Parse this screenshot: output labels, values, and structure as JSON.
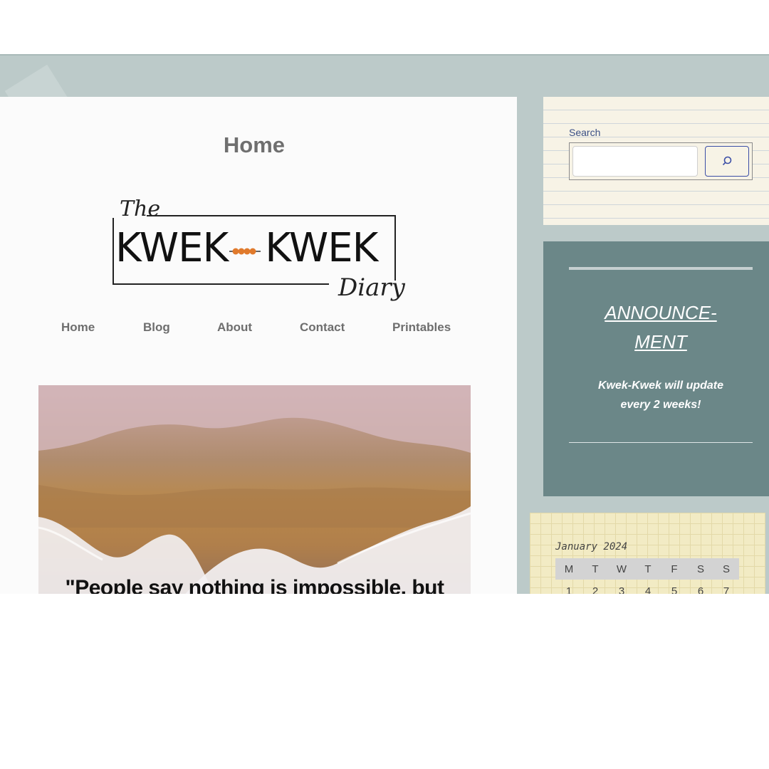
{
  "page": {
    "title": "Home"
  },
  "logo": {
    "the": "The",
    "brand": "KWEK",
    "brand2": "KWEK",
    "diary": "Diary"
  },
  "nav": {
    "items": [
      "Home",
      "Blog",
      "About",
      "Contact",
      "Printables"
    ]
  },
  "hero": {
    "quote": "\"People say nothing is impossible, but"
  },
  "search": {
    "label": "Search",
    "placeholder": "",
    "button_icon": "search-icon"
  },
  "announcement": {
    "title_line1": "ANNOUNCE-",
    "title_line2": "MENT",
    "text_line1": "Kwek-Kwek will update",
    "text_line2": "every 2 weeks!"
  },
  "calendar": {
    "title": "January 2024",
    "weekdays": [
      "M",
      "T",
      "W",
      "T",
      "F",
      "S",
      "S"
    ],
    "first_row": [
      "1",
      "2",
      "3",
      "4",
      "5",
      "6",
      "7"
    ]
  },
  "colors": {
    "background": "#bccac9",
    "announce_bg": "#6b8788",
    "search_accent": "#3b4ea6",
    "logo_egg": "#e07a2c"
  }
}
